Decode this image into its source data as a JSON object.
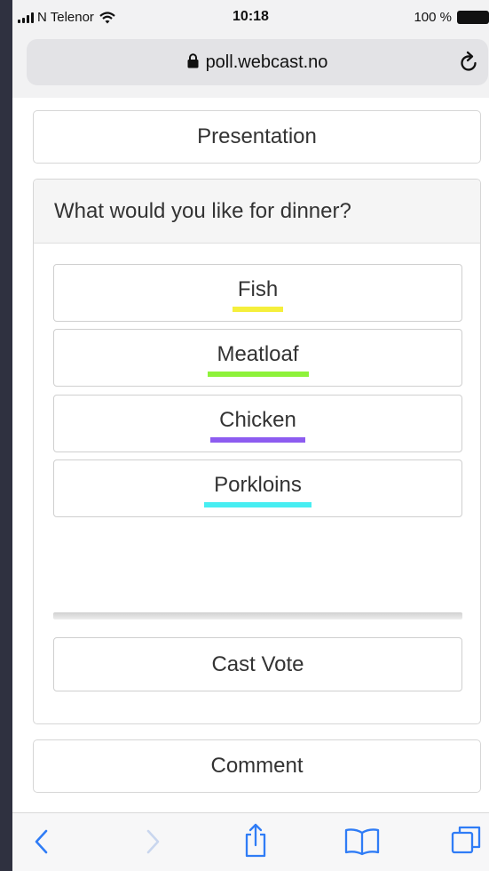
{
  "status": {
    "carrier": "N Telenor",
    "time": "10:18",
    "battery": "100 %"
  },
  "browser": {
    "url": "poll.webcast.no"
  },
  "page": {
    "presentation_label": "Presentation",
    "question": "What would you like for dinner?",
    "options": [
      {
        "label": "Fish",
        "color": "#f5ef3c"
      },
      {
        "label": "Meatloaf",
        "color": "#8ef23a"
      },
      {
        "label": "Chicken",
        "color": "#8d5cf0"
      },
      {
        "label": "Porkloins",
        "color": "#47eef2"
      }
    ],
    "cast_vote_label": "Cast Vote",
    "comment_label": "Comment"
  },
  "toolbar": {
    "icons": [
      "back-icon",
      "forward-icon",
      "share-icon",
      "bookmarks-icon",
      "tabs-icon"
    ]
  },
  "colors": {
    "ios_blue": "#2f7cf6",
    "disabled": "#c9d6ee"
  }
}
